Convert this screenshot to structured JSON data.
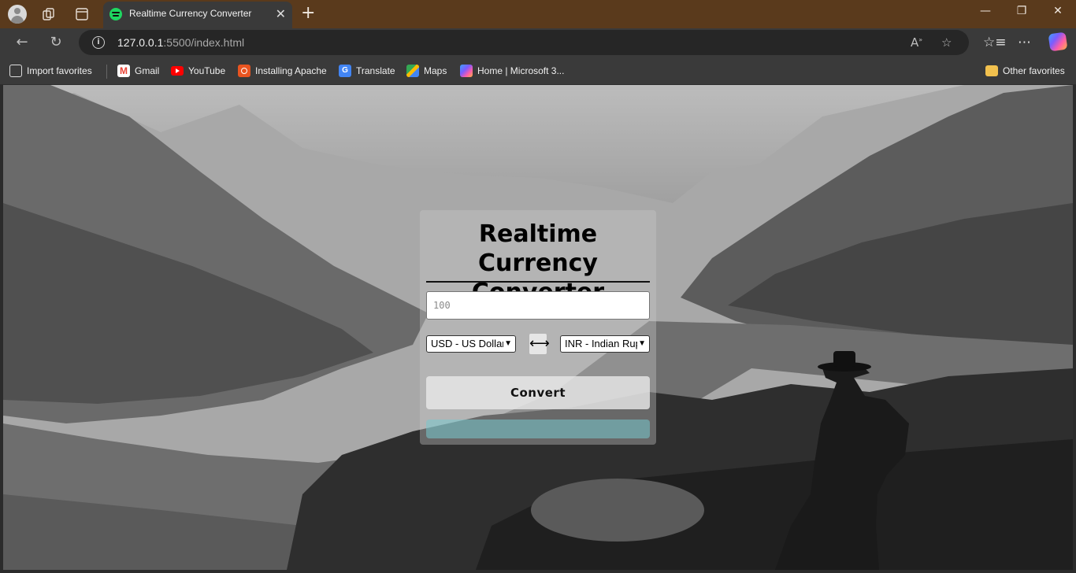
{
  "browser": {
    "tab": {
      "title": "Realtime Currency Converter",
      "favicon": "spotify-icon",
      "close_glyph": "✕"
    },
    "new_tab_glyph": "+",
    "window_controls": {
      "minimize": "—",
      "restore": "❐",
      "close": "✕"
    },
    "address": {
      "host": "127.0.0.1",
      "path": ":5500/index.html"
    },
    "favorites": [
      {
        "label": "Import favorites",
        "icon": "import-icon"
      },
      {
        "label": "Gmail",
        "icon": "gmail-icon"
      },
      {
        "label": "YouTube",
        "icon": "youtube-icon"
      },
      {
        "label": "Installing Apache",
        "icon": "ubuntu-icon"
      },
      {
        "label": "Translate",
        "icon": "translate-icon"
      },
      {
        "label": "Maps",
        "icon": "maps-icon"
      },
      {
        "label": "Home | Microsoft 3...",
        "icon": "microsoft365-icon"
      }
    ],
    "other_favorites": "Other favorites",
    "colors": {
      "frame": "#5a3a1c",
      "toolbar": "#3a3a3a",
      "omnibox": "#262626"
    }
  },
  "app": {
    "title": "Realtime Currency Converter",
    "amount_placeholder": "100",
    "from_currency": "USD - US Dollar",
    "to_currency": "INR - Indian Rupee",
    "swap_glyph": "⟷",
    "convert_label": "Convert",
    "colors": {
      "result_bar": "#78c8cd"
    }
  }
}
